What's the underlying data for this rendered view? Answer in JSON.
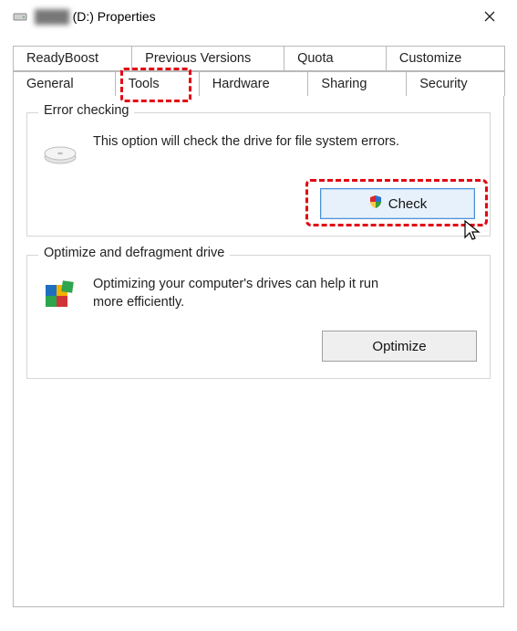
{
  "window": {
    "drive_label_hidden": "████",
    "drive_suffix": "(D:) Properties"
  },
  "tabs": {
    "row1": [
      "ReadyBoost",
      "Previous Versions",
      "Quota",
      "Customize"
    ],
    "row2": [
      "General",
      "Tools",
      "Hardware",
      "Sharing",
      "Security"
    ],
    "active": "Tools"
  },
  "error_checking": {
    "legend": "Error checking",
    "desc": "This option will check the drive for file system errors.",
    "button": "Check"
  },
  "optimize": {
    "legend": "Optimize and defragment drive",
    "desc": "Optimizing your computer's drives can help it run more efficiently.",
    "button": "Optimize"
  }
}
